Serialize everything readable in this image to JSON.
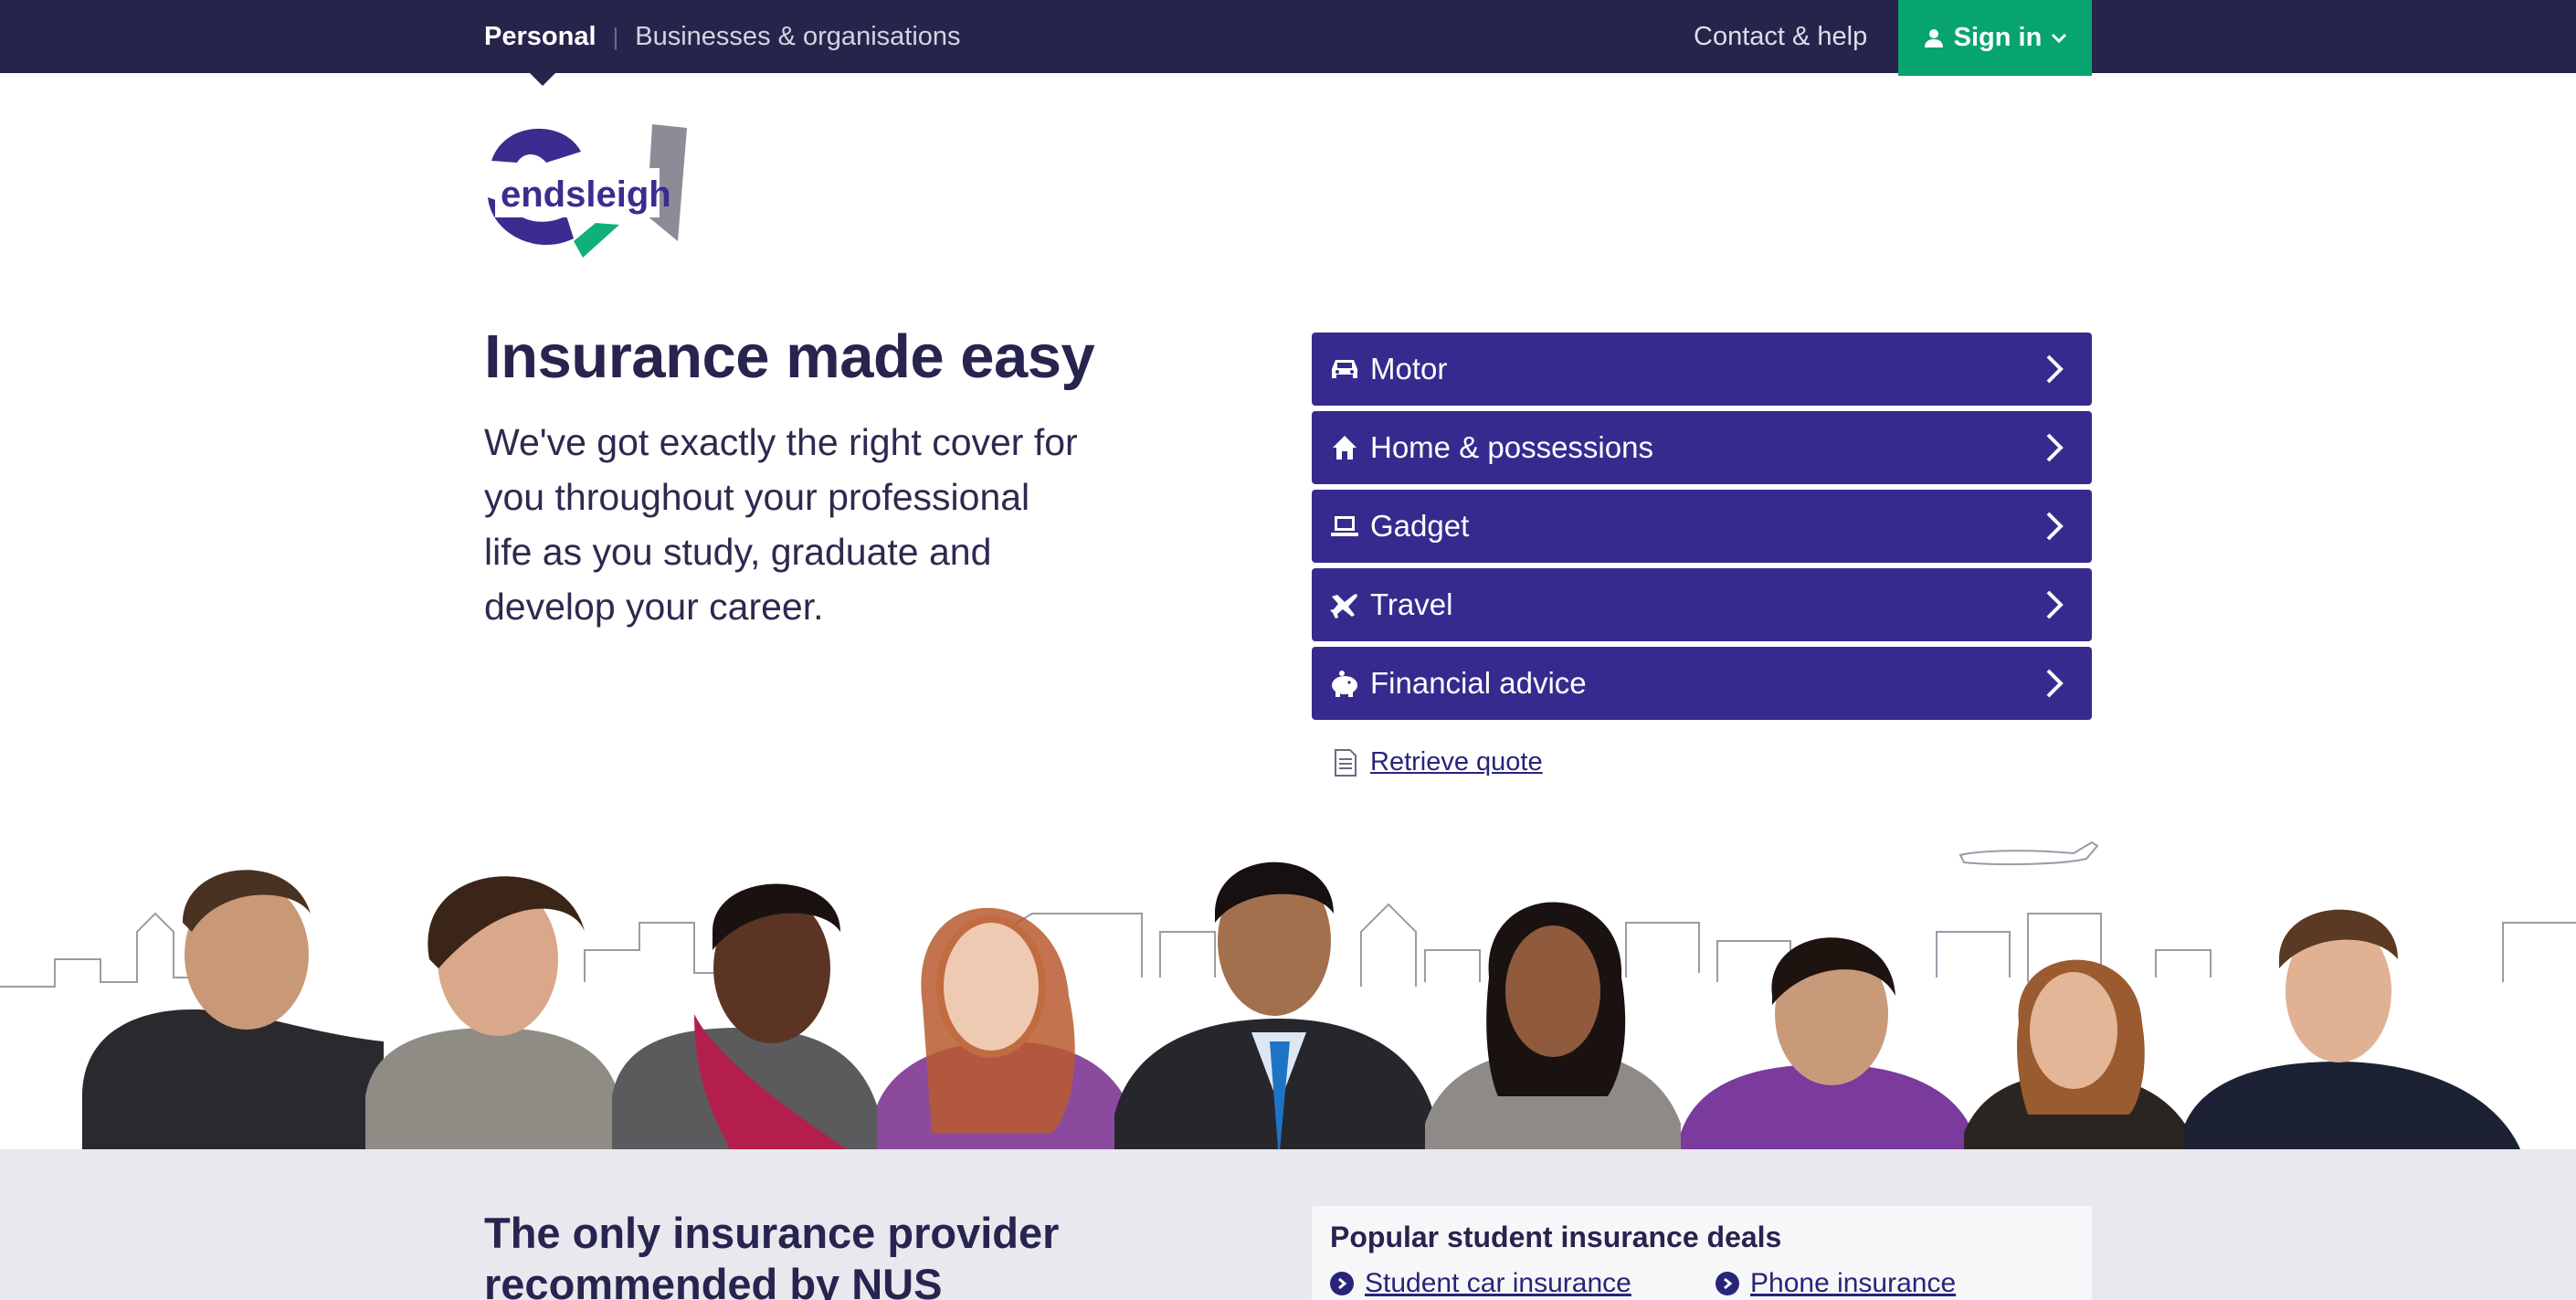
{
  "topbar": {
    "personal": "Personal",
    "separator": "|",
    "businesses": "Businesses & organisations",
    "contact": "Contact & help",
    "signin": "Sign in"
  },
  "logo": {
    "text": "endsleigh"
  },
  "hero": {
    "title": "Insurance made easy",
    "line1": "We've got exactly the right cover for",
    "line2": "you throughout your professional",
    "line3": "life as you study, graduate and",
    "line4": "develop your career."
  },
  "products": [
    {
      "label": "Motor",
      "icon": "car-icon"
    },
    {
      "label": "Home & possessions",
      "icon": "house-icon"
    },
    {
      "label": "Gadget",
      "icon": "laptop-icon"
    },
    {
      "label": "Travel",
      "icon": "plane-icon"
    },
    {
      "label": "Financial advice",
      "icon": "piggy-bank-icon"
    }
  ],
  "retrieve": {
    "label": "Retrieve quote",
    "icon": "document-icon"
  },
  "nus": {
    "title": "The only insurance provider recommended by NUS"
  },
  "deals": {
    "title": "Popular student insurance deals",
    "items": [
      "Student car insurance",
      "Phone insurance"
    ]
  },
  "colors": {
    "navy": "#27244c",
    "purple_button": "#372a8f",
    "green": "#07a46f",
    "gray_section": "#e8e8ee"
  }
}
